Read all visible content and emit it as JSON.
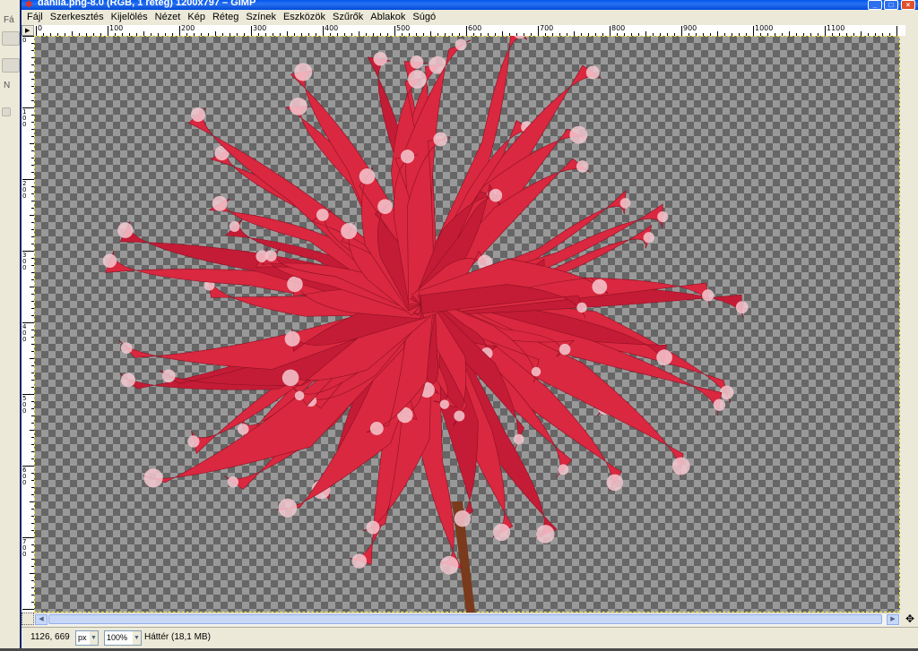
{
  "window": {
    "title": "dahlia.png-8.0 (RGB, 1 réteg) 1200x797 – GIMP",
    "min_label": "_",
    "max_label": "□",
    "close_label": "×"
  },
  "menubar": {
    "items": [
      {
        "label": "Fájl"
      },
      {
        "label": "Szerkesztés"
      },
      {
        "label": "Kijelölés"
      },
      {
        "label": "Nézet"
      },
      {
        "label": "Kép"
      },
      {
        "label": "Réteg"
      },
      {
        "label": "Színek"
      },
      {
        "label": "Eszközök"
      },
      {
        "label": "Szűrők"
      },
      {
        "label": "Ablakok"
      },
      {
        "label": "Súgó"
      }
    ]
  },
  "background_window": {
    "letter1": "Fá",
    "letter2": "N"
  },
  "ruler": {
    "horizontal_labels": [
      "0",
      "100",
      "200",
      "300",
      "400",
      "500",
      "600",
      "700",
      "800",
      "900",
      "1000",
      "1100"
    ],
    "vertical_labels": [
      "0",
      "100",
      "200",
      "300",
      "400",
      "500",
      "600",
      "700"
    ]
  },
  "statusbar": {
    "pointer_coords": "1126, 669",
    "unit": "px",
    "zoom": "100%",
    "layer_info": "Háttér (18,1 MB)"
  },
  "icons": {
    "app": "gimp-icon",
    "navigate": "navigate-cross-icon",
    "quick_mask": "quick-mask-icon"
  },
  "colors": {
    "titlebar": "#0058ee",
    "petal": "#d9283f",
    "petal_tip": "#f4c8d0",
    "checker_dark": "#666666",
    "checker_light": "#999999"
  }
}
